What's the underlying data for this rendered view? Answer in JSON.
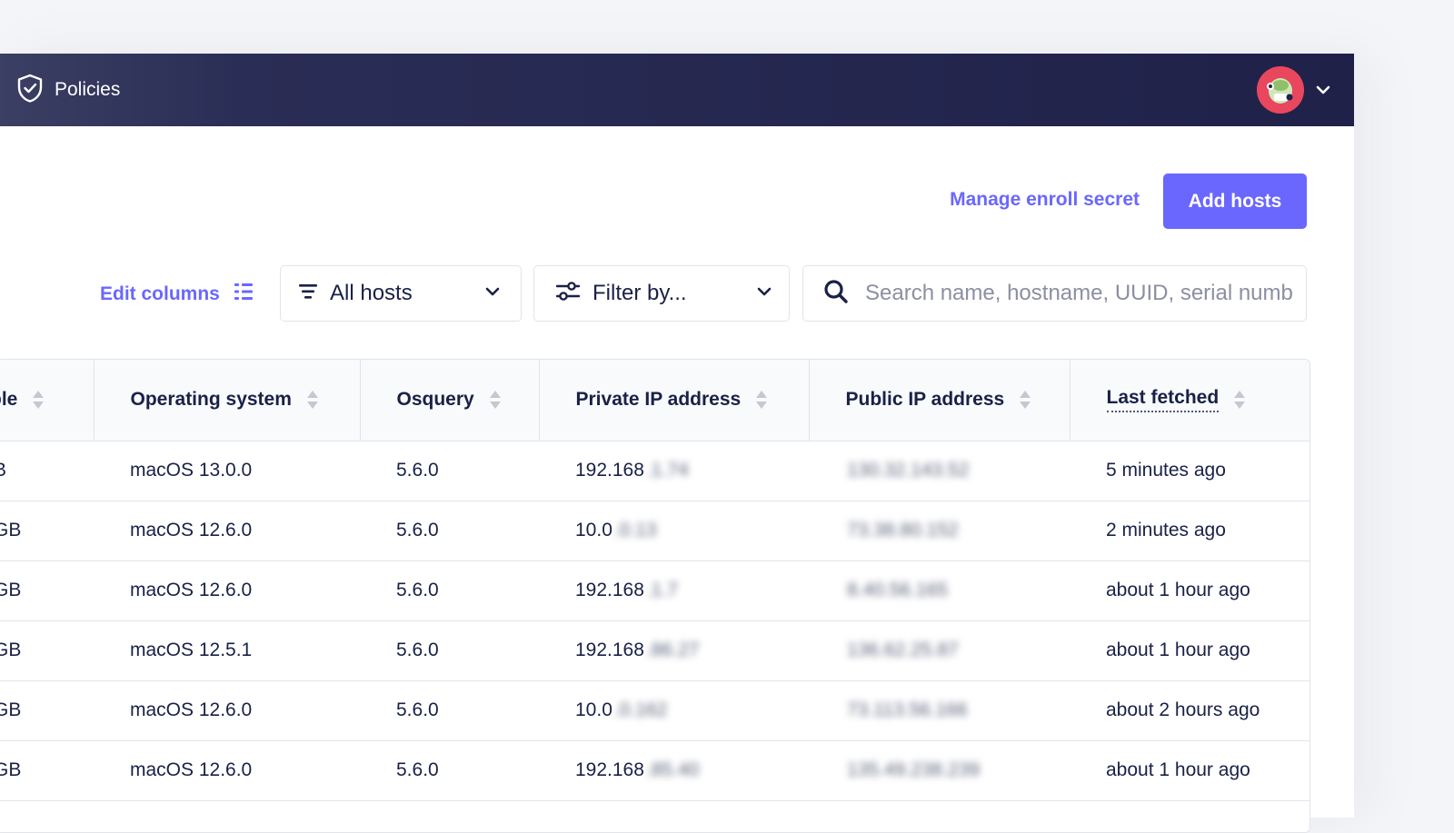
{
  "nav": {
    "policies_label": "Policies"
  },
  "actions": {
    "manage_enroll_secret": "Manage enroll secret",
    "add_hosts": "Add hosts"
  },
  "controls": {
    "edit_columns": "Edit columns",
    "hosts_dropdown": "All hosts",
    "filter_dropdown": "Filter by...",
    "search_placeholder": "Search name, hostname, UUID, serial number"
  },
  "table": {
    "headers": [
      "ble",
      "Operating system",
      "Osquery",
      "Private IP address",
      "Public IP address",
      "Last fetched"
    ],
    "rows": [
      {
        "c0": "B",
        "os": "macOS 13.0.0",
        "osquery": "5.6.0",
        "private_ip": "192.168",
        "private_ip_hidden": ".1.74",
        "public_ip_hidden": "130.32.143.52",
        "last_fetched": "5 minutes ago"
      },
      {
        "c0": "GB",
        "os": "macOS 12.6.0",
        "osquery": "5.6.0",
        "private_ip": "10.0",
        "private_ip_hidden": ".0.13",
        "public_ip_hidden": "73.38.80.152",
        "last_fetched": "2 minutes ago"
      },
      {
        "c0": "GB",
        "os": "macOS 12.6.0",
        "osquery": "5.6.0",
        "private_ip": "192.168",
        "private_ip_hidden": ".1.7",
        "public_ip_hidden": "8.40.56.165",
        "last_fetched": "about 1 hour ago"
      },
      {
        "c0": "GB",
        "os": "macOS 12.5.1",
        "osquery": "5.6.0",
        "private_ip": "192.168",
        "private_ip_hidden": ".86.27",
        "public_ip_hidden": "136.62.25.87",
        "last_fetched": "about 1 hour ago"
      },
      {
        "c0": "GB",
        "os": "macOS 12.6.0",
        "osquery": "5.6.0",
        "private_ip": "10.0",
        "private_ip_hidden": ".0.162",
        "public_ip_hidden": "73.113.56.166",
        "last_fetched": "about 2 hours ago"
      },
      {
        "c0": "GB",
        "os": "macOS 12.6.0",
        "osquery": "5.6.0",
        "private_ip": "192.168",
        "private_ip_hidden": ".85.40",
        "public_ip_hidden": "135.49.238.239",
        "last_fetched": "about 1 hour ago"
      }
    ]
  },
  "colors": {
    "accent": "#6a67fe",
    "nav_bg": "#1f2149",
    "text": "#192147",
    "border": "#e2e4ea",
    "avatar_bg": "#e8475d"
  },
  "icons": {
    "policies": "shield-check-icon",
    "account_menu": "chevron-down-icon",
    "edit_columns": "columns-list-icon",
    "hosts_dropdown": "filter-lines-icon",
    "filter_dropdown": "sliders-icon",
    "search": "search-icon",
    "sort": "sort-arrows-icon"
  }
}
